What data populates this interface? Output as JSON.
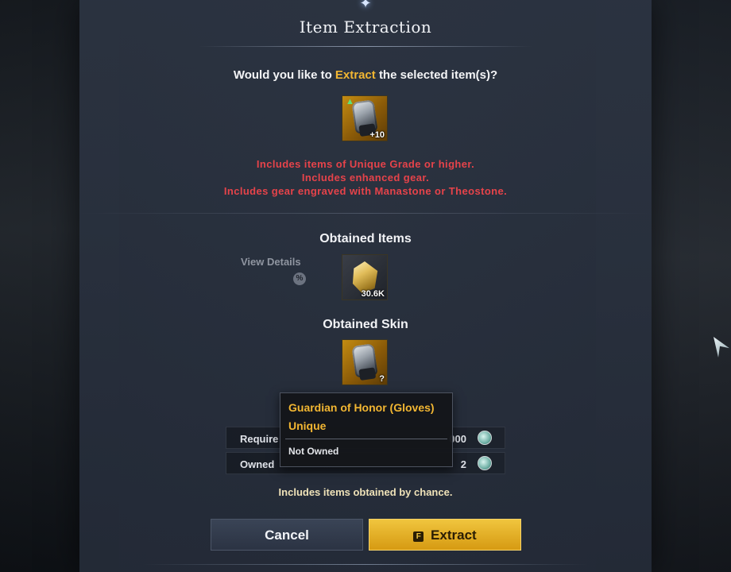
{
  "dialog": {
    "title": "Item Extraction",
    "question_prefix": "Would you like to",
    "question_accent": "Extract",
    "question_suffix": "the selected item(s)?"
  },
  "selected_item": {
    "icon": "gauntlet-icon",
    "enhance_label": "+10"
  },
  "warnings": [
    "Includes items of Unique Grade or higher.",
    "Includes enhanced gear.",
    "Includes gear engraved with Manastone or Theostone."
  ],
  "obtained_items": {
    "title": "Obtained Items",
    "view_details": "View Details",
    "percent_icon": "%",
    "item": {
      "icon": "crystal-icon",
      "qty": "30.6K"
    }
  },
  "obtained_skin": {
    "title": "Obtained Skin",
    "item": {
      "icon": "gauntlet-icon",
      "qty": "?"
    }
  },
  "costs": [
    {
      "label": "Require",
      "value": "000",
      "icon": "kinah-coin-icon"
    },
    {
      "label": "Owned",
      "value": "2",
      "icon": "kinah-coin-icon"
    }
  ],
  "tooltip": {
    "name": "Guardian of Honor (Gloves)",
    "grade": "Unique",
    "owned_status": "Not Owned"
  },
  "chance_note": "Includes items obtained by chance.",
  "buttons": {
    "cancel": "Cancel",
    "extract_key": "F",
    "extract": "Extract"
  },
  "colors": {
    "accent": "#f2b632",
    "warning": "#e6434a",
    "extract_button": "#e0ab22"
  }
}
